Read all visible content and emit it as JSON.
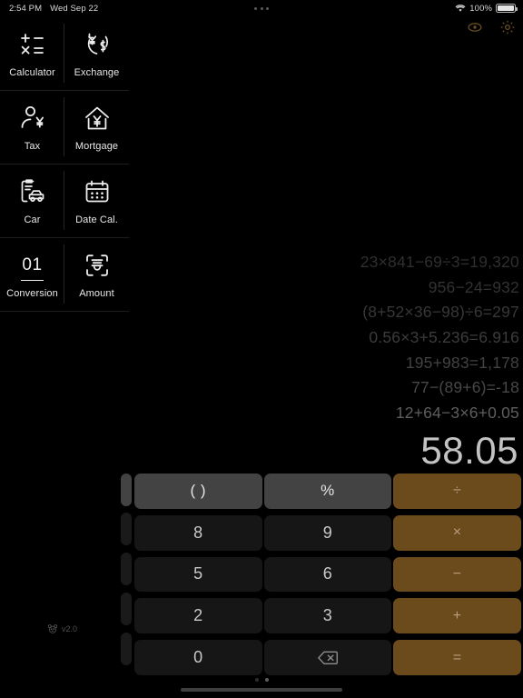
{
  "status_bar": {
    "time": "2:54 PM",
    "date": "Wed Sep 22",
    "battery_percent": "100%",
    "wifi_icon": "wifi-icon",
    "battery_icon": "battery-full-icon",
    "multitask_handle_icon": "three-dots-handle-icon"
  },
  "top_actions": {
    "eye_icon": "eye-icon",
    "settings_icon": "gear-icon",
    "accent_color": "#6b4e22"
  },
  "sidebar": {
    "tiles": [
      {
        "label": "Calculator",
        "icon": "calculator-icon"
      },
      {
        "label": "Exchange",
        "icon": "currency-exchange-icon"
      },
      {
        "label": "Tax",
        "icon": "person-yen-tax-icon"
      },
      {
        "label": "Mortgage",
        "icon": "house-yen-mortgage-icon"
      },
      {
        "label": "Car",
        "icon": "car-loan-icon"
      },
      {
        "label": "Date Cal.",
        "icon": "calendar-icon"
      },
      {
        "label": "Conversion",
        "icon": "digits-01-icon",
        "icon_text": "01"
      },
      {
        "label": "Amount",
        "icon": "amount-scan-icon"
      }
    ],
    "version_label": "v2.0",
    "version_icon": "bear-face-icon"
  },
  "display": {
    "history": [
      "23×841−69÷3=19,320",
      "956−24=932",
      "(8+52×36−98)÷6=297",
      "0.56×3+5.236=6.916",
      "195+983=1,178",
      "77−(89+6)=-18",
      "12+64−3×6+0.05"
    ],
    "result": "58.05"
  },
  "keypad": {
    "keys": [
      {
        "label": "( )",
        "type": "fn",
        "name": "parentheses-key"
      },
      {
        "label": "%",
        "type": "fn",
        "name": "percent-key"
      },
      {
        "label": "÷",
        "type": "op",
        "name": "divide-key"
      },
      {
        "label": "8",
        "type": "num",
        "name": "digit-8-key"
      },
      {
        "label": "9",
        "type": "num",
        "name": "digit-9-key"
      },
      {
        "label": "×",
        "type": "op",
        "name": "multiply-key"
      },
      {
        "label": "5",
        "type": "num",
        "name": "digit-5-key"
      },
      {
        "label": "6",
        "type": "num",
        "name": "digit-6-key"
      },
      {
        "label": "−",
        "type": "op",
        "name": "subtract-key"
      },
      {
        "label": "2",
        "type": "num",
        "name": "digit-2-key"
      },
      {
        "label": "3",
        "type": "num",
        "name": "digit-3-key"
      },
      {
        "label": "+",
        "type": "op",
        "name": "add-key"
      },
      {
        "label": "0",
        "type": "num",
        "name": "digit-0-key"
      },
      {
        "label": "",
        "type": "num",
        "name": "backspace-key",
        "icon": "backspace-icon"
      },
      {
        "label": "=",
        "type": "op",
        "name": "equals-key"
      }
    ],
    "operator_color": "#6b4a1c",
    "function_color": "#434343",
    "number_color": "#161616"
  },
  "page_indicator": {
    "count": 2,
    "active_index": 1
  }
}
